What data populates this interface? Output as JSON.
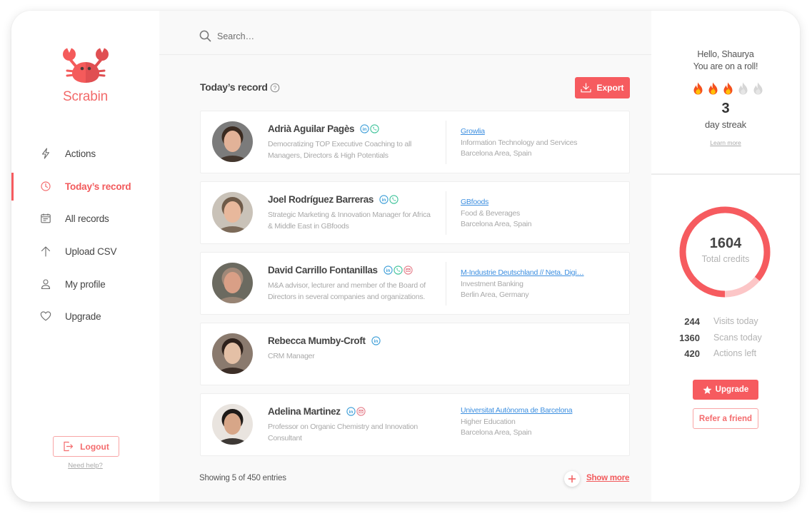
{
  "app": {
    "name": "Scrabin",
    "accent": "#f65b5f"
  },
  "sidebar": {
    "items": [
      {
        "label": "Actions",
        "icon": "lightning-icon",
        "active": false
      },
      {
        "label": "Today’s record",
        "icon": "clock-icon",
        "active": true
      },
      {
        "label": "All records",
        "icon": "calendar-icon",
        "active": false
      },
      {
        "label": "Upload CSV",
        "icon": "arrow-up-icon",
        "active": false
      },
      {
        "label": "My profile",
        "icon": "user-icon",
        "active": false
      },
      {
        "label": "Upgrade",
        "icon": "heart-icon",
        "active": false
      }
    ],
    "logout_label": "Logout",
    "help_link": "Need help?"
  },
  "search": {
    "placeholder": "Search…",
    "value": ""
  },
  "main": {
    "title": "Today’s record",
    "export_label": "Export",
    "records": [
      {
        "name": "Adrià Aguilar Pagès",
        "contacts": [
          "linkedin",
          "phone"
        ],
        "description": "Democratizing TOP Executive Coaching to all Managers, Directors & High Potentials",
        "company": "Growlia",
        "industry": "Information Technology and Services",
        "location": "Barcelona Area, Spain"
      },
      {
        "name": "Joel Rodríguez Barreras",
        "contacts": [
          "linkedin",
          "phone"
        ],
        "description": "Strategic Marketing & Innovation Manager for Africa & Middle East in GBfoods",
        "company": "GBfoods",
        "industry": "Food & Beverages",
        "location": "Barcelona Area, Spain"
      },
      {
        "name": "David Carrillo Fontanillas",
        "contacts": [
          "linkedin",
          "phone",
          "email"
        ],
        "description": "M&A advisor, lecturer and member of the Board of Directors in several companies and organizations.",
        "company": "M-Industrie Deutschland // Neta. Digi…",
        "industry": "Investment Banking",
        "location": "Berlin Area, Germany"
      },
      {
        "name": "Rebecca Mumby-Croft",
        "contacts": [
          "linkedin"
        ],
        "description": "CRM Manager",
        "company": null,
        "industry": null,
        "location": null
      },
      {
        "name": "Adelina Martinez",
        "contacts": [
          "linkedin",
          "email"
        ],
        "description": "Professor on Organic Chemistry and Innovation Consultant",
        "company": "Universitat Autònoma de Barcelona",
        "industry": "Higher Education",
        "location": "Barcelona Area, Spain"
      }
    ],
    "footer": {
      "showing": "Showing 5 of 450 entries",
      "show_more": "Show more"
    }
  },
  "right_panel": {
    "greeting": "Hello, Shaurya",
    "subgreeting": "You are on a roll!",
    "streak": {
      "days": "3",
      "label": "day streak",
      "flames_total": 5,
      "flames_active": 3,
      "learn_more": "Learn more"
    },
    "credits": {
      "total": "1604",
      "label": "Total credits",
      "used_fraction": 0.86
    },
    "stats": [
      {
        "value": "244",
        "label": "Visits today"
      },
      {
        "value": "1360",
        "label": "Scans today"
      },
      {
        "value": "420",
        "label": "Actions left"
      }
    ],
    "upgrade_label": "Upgrade",
    "refer_label": "Refer a friend"
  }
}
